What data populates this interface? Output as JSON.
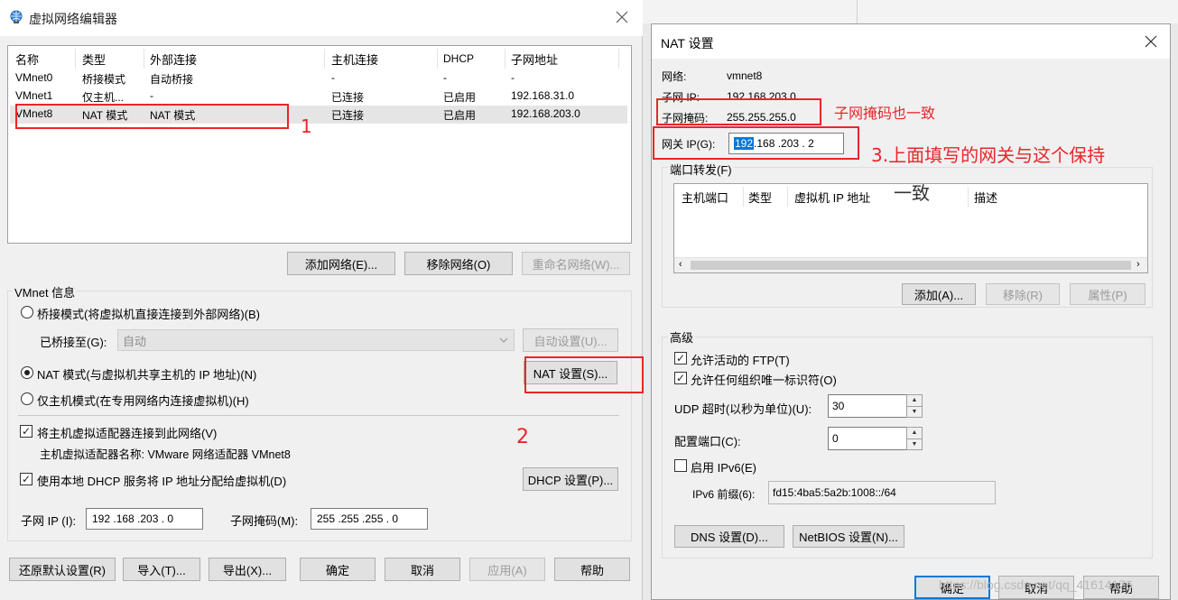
{
  "left_window": {
    "title": "虚拟网络编辑器",
    "columns": [
      "名称",
      "类型",
      "外部连接",
      "主机连接",
      "DHCP",
      "子网地址"
    ],
    "rows": [
      [
        "VMnet0",
        "桥接模式",
        "自动桥接",
        "-",
        "-",
        "-"
      ],
      [
        "VMnet1",
        "仅主机...",
        "-",
        "已连接",
        "已启用",
        "192.168.31.0"
      ],
      [
        "VMnet8",
        "NAT 模式",
        "NAT 模式",
        "已连接",
        "已启用",
        "192.168.203.0"
      ]
    ],
    "add_network": "添加网络(E)...",
    "remove_network": "移除网络(O)",
    "rename_network": "重命名网络(W)...",
    "vmnet_info": "VMnet 信息",
    "bridged_mode": "桥接模式(将虚拟机直接连接到外部网络)(B)",
    "bridged_to_label": "已桥接至(G):",
    "bridged_to_value": "自动",
    "auto_settings": "自动设置(U)...",
    "nat_mode": "NAT 模式(与虚拟机共享主机的 IP 地址)(N)",
    "nat_settings": "NAT 设置(S)...",
    "host_only_mode": "仅主机模式(在专用网络内连接虚拟机)(H)",
    "connect_adapter": "将主机虚拟适配器连接到此网络(V)",
    "adapter_name": "主机虚拟适配器名称: VMware 网络适配器 VMnet8",
    "use_dhcp": "使用本地 DHCP 服务将 IP 地址分配给虚拟机(D)",
    "dhcp_settings": "DHCP 设置(P)...",
    "subnet_ip_label": "子网 IP (I):",
    "subnet_ip_value": "192 .168 .203 .  0",
    "subnet_mask_label": "子网掩码(M):",
    "subnet_mask_value": "255 .255 .255 .  0",
    "restore_defaults": "还原默认设置(R)",
    "import": "导入(T)...",
    "export": "导出(X)...",
    "ok": "确定",
    "cancel": "取消",
    "apply": "应用(A)",
    "help": "帮助"
  },
  "nat_dialog": {
    "title": "NAT 设置",
    "network_label": "网络:",
    "network_value": "vmnet8",
    "subnet_ip_label": "子网 IP:",
    "subnet_ip_value": "192.168.203.0",
    "subnet_mask_label": "子网掩码:",
    "subnet_mask_value": "255.255.255.0",
    "gateway_label": "网关 IP(G):",
    "gateway_first": "192",
    "gateway_rest": " .168 .203 .  2",
    "port_forwarding": "端口转发(F)",
    "pf_columns": [
      "主机端口",
      "类型",
      "虚拟机 IP 地址",
      "描述"
    ],
    "pf_add": "添加(A)...",
    "pf_remove": "移除(R)",
    "pf_properties": "属性(P)",
    "advanced": "高级",
    "allow_ftp": "允许活动的 FTP(T)",
    "allow_oui": "允许任何组织唯一标识符(O)",
    "udp_timeout_label": "UDP 超时(以秒为单位)(U):",
    "udp_timeout_value": "30",
    "config_port_label": "配置端口(C):",
    "config_port_value": "0",
    "enable_ipv6": "启用 IPv6(E)",
    "ipv6_prefix_label": "IPv6 前缀(6):",
    "ipv6_prefix_value": "fd15:4ba5:5a2b:1008::/64",
    "dns_settings": "DNS 设置(D)...",
    "netbios_settings": "NetBIOS 设置(N)...",
    "ok": "确定",
    "cancel": "取消",
    "help": "帮助"
  },
  "annotations": {
    "num1": "1",
    "num2": "2",
    "mask_note": "子网掩码也一致",
    "gateway_note_line1": "3.上面填写的网关与这个保持",
    "gateway_note_line2": "一致",
    "color": "#e8262a"
  },
  "watermark": "https://blog.csdn.net/qq_41614176"
}
